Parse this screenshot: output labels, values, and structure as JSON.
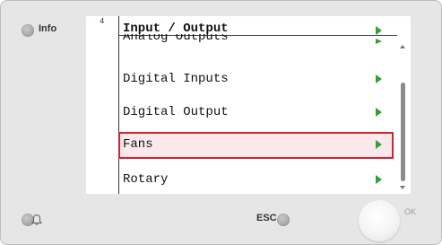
{
  "hardware": {
    "info_label": "Info",
    "esc_label": "ESC",
    "ok_label": "OK",
    "alarm_icon": "bell-icon"
  },
  "screen": {
    "page_number": "4",
    "menu_title": "Input / Output",
    "items": [
      {
        "label": "Analog Outputs",
        "clipped": true
      },
      {
        "label": "Digital Inputs"
      },
      {
        "label": "Digital Output"
      },
      {
        "label": "Fans",
        "selected": true
      },
      {
        "label": "Rotary"
      }
    ],
    "colors": {
      "arrow": "#2fa32f",
      "selection_border": "#d3212f",
      "selection_fill": "#fbe8ea"
    }
  }
}
